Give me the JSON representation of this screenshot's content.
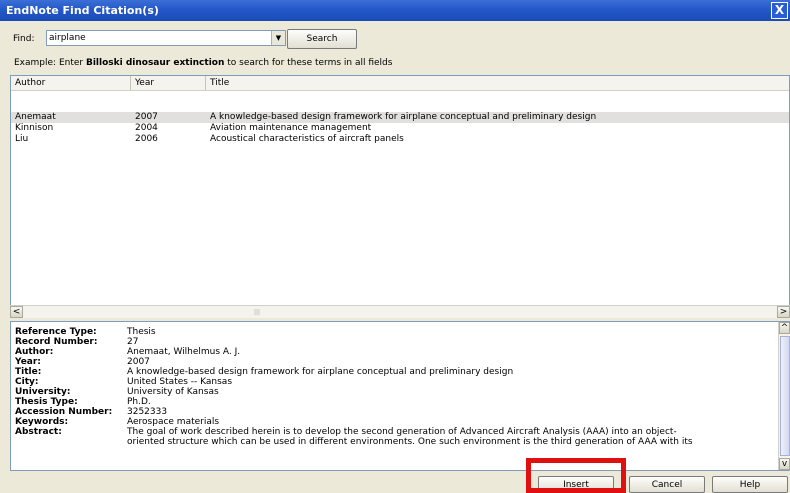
{
  "window": {
    "title": "EndNote Find Citation(s)",
    "close_glyph": "X"
  },
  "find": {
    "label": "Find:",
    "value": "airplane",
    "search_label": "Search"
  },
  "example": {
    "prefix": "Example: Enter ",
    "bold": "Billoski dinosaur extinction",
    "suffix": " to search for these terms in all fields"
  },
  "results": {
    "columns": [
      "Author",
      "Year",
      "Title"
    ],
    "rows": [
      {
        "author": "Anemaat",
        "year": "2007",
        "title": "A knowledge-based design framework for airplane conceptual and preliminary design"
      },
      {
        "author": "Kinnison",
        "year": "2004",
        "title": "Aviation maintenance management"
      },
      {
        "author": "Liu",
        "year": "2006",
        "title": "Acoustical characteristics of aircraft panels"
      }
    ]
  },
  "details": [
    {
      "label": "Reference Type:",
      "value": "Thesis"
    },
    {
      "label": "Record Number:",
      "value": "27"
    },
    {
      "label": "Author:",
      "value": "Anemaat, Wilhelmus A. J."
    },
    {
      "label": "Year:",
      "value": "2007"
    },
    {
      "label": "Title:",
      "value": "A knowledge-based design framework for airplane conceptual and preliminary design"
    },
    {
      "label": "City:",
      "value": "United States -- Kansas"
    },
    {
      "label": "University:",
      "value": "University of Kansas"
    },
    {
      "label": "Thesis Type:",
      "value": "Ph.D."
    },
    {
      "label": "Accession Number:",
      "value": "3252333"
    },
    {
      "label": "Keywords:",
      "value": "Aerospace materials"
    },
    {
      "label": "Abstract:",
      "value": "The goal of work described herein is to develop the second generation of Advanced Aircraft Analysis (AAA) into an object-"
    },
    {
      "label": "",
      "value": "oriented structure which can be used in different environments. One such environment is the third generation of AAA with its"
    }
  ],
  "buttons": {
    "insert": "Insert",
    "cancel": "Cancel",
    "help": "Help"
  },
  "colors": {
    "titlebar": "#2458c8",
    "highlight": "#e01010",
    "selected_row": "#e1e0de"
  }
}
